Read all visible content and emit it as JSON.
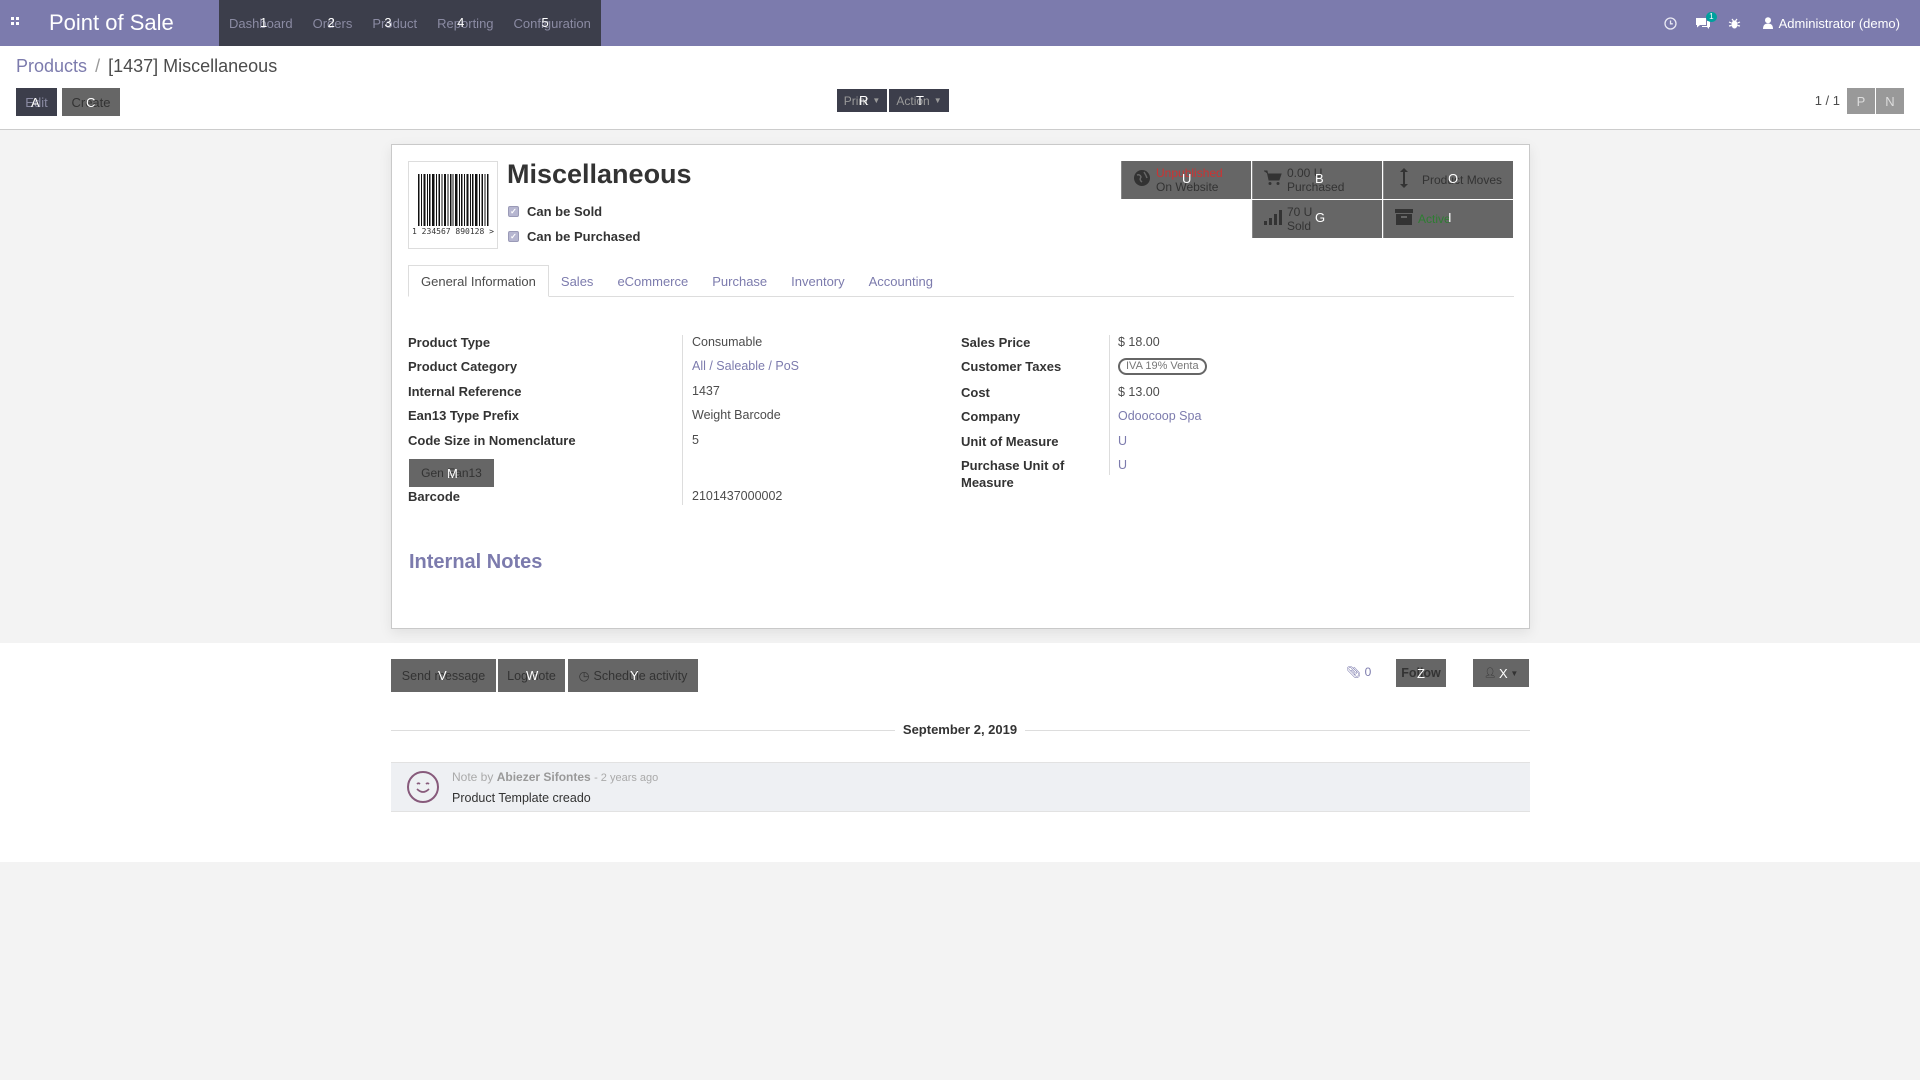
{
  "navbar": {
    "app_title": "Point of Sale",
    "menu": [
      {
        "label": "Dashboard",
        "hint": "1"
      },
      {
        "label": "Orders",
        "hint": "2"
      },
      {
        "label": "Product",
        "hint": "3"
      },
      {
        "label": "Reporting",
        "hint": "4"
      },
      {
        "label": "Configuration",
        "hint": "5"
      }
    ],
    "messages_badge": "1",
    "user": "Administrator (demo)"
  },
  "control_panel": {
    "breadcrumb_parent": "Products",
    "breadcrumb_sep": "/",
    "breadcrumb_current": "[1437] Miscellaneous",
    "edit_label": "Edit",
    "edit_hint": "A",
    "create_label": "Create",
    "create_hint": "C",
    "print_label": "Print",
    "print_hint": "R",
    "action_label": "Action",
    "action_hint": "T",
    "pager": "1 / 1",
    "prev_hint": "P",
    "next_hint": "N"
  },
  "form": {
    "title": "Miscellaneous",
    "barcode_image_number": "1 234567 890128 >",
    "can_be_sold": "Can be Sold",
    "can_be_purchased": "Can be Purchased",
    "smart_buttons": {
      "website_line1": "Unpublished",
      "website_line2": "On Website",
      "website_hint": "U",
      "purchased_line1": "0.00 U",
      "purchased_line2": "Purchased",
      "purchased_hint": "B",
      "moves_label": "Product Moves",
      "moves_hint": "O",
      "sold_line1": "70 U",
      "sold_line2": "Sold",
      "sold_hint": "G",
      "active_label": "Active",
      "active_hint": "I"
    },
    "tabs": [
      "General Information",
      "Sales",
      "eCommerce",
      "Purchase",
      "Inventory",
      "Accounting"
    ],
    "left_fields": {
      "product_type_label": "Product Type",
      "product_type_value": "Consumable",
      "category_label": "Product Category",
      "category_value": "All / Saleable / PoS",
      "internal_ref_label": "Internal Reference",
      "internal_ref_value": "1437",
      "ean_prefix_label": "Ean13 Type Prefix",
      "ean_prefix_value": "Weight Barcode",
      "code_size_label": "Code Size in Nomenclature",
      "code_size_value": "5",
      "gen_button_label": "Gen Ean13",
      "gen_button_hint": "M",
      "barcode_label": "Barcode",
      "barcode_value": "2101437000002"
    },
    "right_fields": {
      "sales_price_label": "Sales Price",
      "sales_price_value": "$ 18.00",
      "customer_taxes_label": "Customer Taxes",
      "customer_taxes_value": "IVA 19% Venta",
      "cost_label": "Cost",
      "cost_value": "$ 13.00",
      "company_label": "Company",
      "company_value": "Odoocoop Spa",
      "uom_label": "Unit of Measure",
      "uom_value": "U",
      "purchase_uom_label": "Purchase Unit of Measure",
      "purchase_uom_value": "U"
    },
    "internal_notes_title": "Internal Notes"
  },
  "chatter": {
    "send_message_label": "Send message",
    "send_message_hint": "V",
    "log_note_label": "Log note",
    "log_note_hint": "W",
    "schedule_label": "Schedule activity",
    "schedule_hint": "Y",
    "attachments_count": "0",
    "follow_label": "Follow",
    "follow_hint": "Z",
    "followers_hint": "X",
    "date_separator": "September 2, 2019",
    "message": {
      "prefix": "Note by",
      "author": "Abiezer Sifontes",
      "time": "- 2 years ago",
      "body": "Product Template creado"
    }
  },
  "colors": {
    "navbar": "#7c7bad",
    "menu_group": "#3c3e4b",
    "link": "#7c7bad",
    "unpublished": "#cc3333",
    "active": "#2e7d32"
  }
}
